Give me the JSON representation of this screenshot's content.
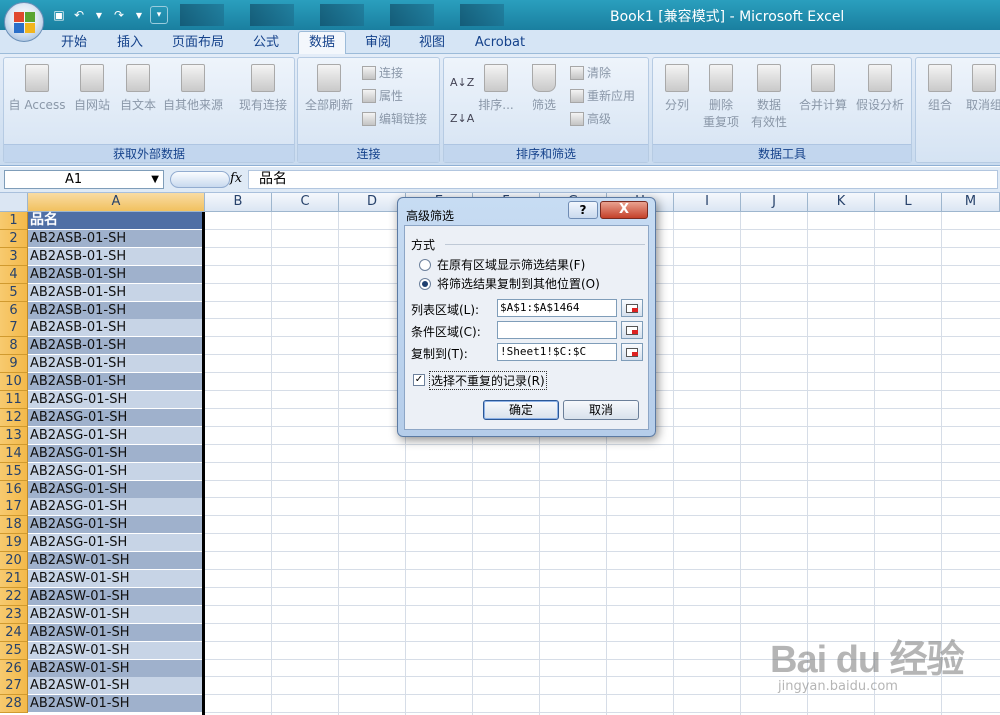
{
  "window": {
    "title": "Book1  [兼容模式] - Microsoft Excel"
  },
  "tabs": [
    {
      "label": "开始"
    },
    {
      "label": "插入"
    },
    {
      "label": "页面布局"
    },
    {
      "label": "公式"
    },
    {
      "label": "数据"
    },
    {
      "label": "审阅"
    },
    {
      "label": "视图"
    },
    {
      "label": "Acrobat"
    }
  ],
  "ribbon": {
    "get_external": {
      "label": "获取外部数据",
      "access": "自 Access",
      "web": "自网站",
      "text": "自文本",
      "other": "自其他来源",
      "existing": "现有连接"
    },
    "connections": {
      "label": "连接",
      "refresh_all": "全部刷新",
      "connect": "连接",
      "properties": "属性",
      "edit_links": "编辑链接"
    },
    "sort_filter": {
      "label": "排序和筛选",
      "sort": "排序...",
      "filter": "筛选",
      "clear": "清除",
      "reapply": "重新应用",
      "advanced": "高级"
    },
    "data_tools": {
      "label": "数据工具",
      "text_to_columns": "分列",
      "remove_dup_1": "删除",
      "remove_dup_2": "重复项",
      "validation_1": "数据",
      "validation_2": "有效性",
      "consolidate": "合并计算",
      "what_if": "假设分析"
    },
    "outline": {
      "group": "组合",
      "ungroup": "取消组"
    }
  },
  "formula_bar": {
    "name_box": "A1",
    "fx": "fx",
    "content": "品名"
  },
  "columns": [
    "A",
    "B",
    "C",
    "D",
    "E",
    "F",
    "G",
    "H",
    "I",
    "J",
    "K",
    "L",
    "M"
  ],
  "rows": [
    {
      "num": "1",
      "value": "品名"
    },
    {
      "num": "2",
      "value": "AB2ASB-01-SH"
    },
    {
      "num": "3",
      "value": "AB2ASB-01-SH"
    },
    {
      "num": "4",
      "value": "AB2ASB-01-SH"
    },
    {
      "num": "5",
      "value": "AB2ASB-01-SH"
    },
    {
      "num": "6",
      "value": "AB2ASB-01-SH"
    },
    {
      "num": "7",
      "value": "AB2ASB-01-SH"
    },
    {
      "num": "8",
      "value": "AB2ASB-01-SH"
    },
    {
      "num": "9",
      "value": "AB2ASB-01-SH"
    },
    {
      "num": "10",
      "value": "AB2ASB-01-SH"
    },
    {
      "num": "11",
      "value": "AB2ASG-01-SH"
    },
    {
      "num": "12",
      "value": "AB2ASG-01-SH"
    },
    {
      "num": "13",
      "value": "AB2ASG-01-SH"
    },
    {
      "num": "14",
      "value": "AB2ASG-01-SH"
    },
    {
      "num": "15",
      "value": "AB2ASG-01-SH"
    },
    {
      "num": "16",
      "value": "AB2ASG-01-SH"
    },
    {
      "num": "17",
      "value": "AB2ASG-01-SH"
    },
    {
      "num": "18",
      "value": "AB2ASG-01-SH"
    },
    {
      "num": "19",
      "value": "AB2ASG-01-SH"
    },
    {
      "num": "20",
      "value": "AB2ASW-01-SH"
    },
    {
      "num": "21",
      "value": "AB2ASW-01-SH"
    },
    {
      "num": "22",
      "value": "AB2ASW-01-SH"
    },
    {
      "num": "23",
      "value": "AB2ASW-01-SH"
    },
    {
      "num": "24",
      "value": "AB2ASW-01-SH"
    },
    {
      "num": "25",
      "value": "AB2ASW-01-SH"
    },
    {
      "num": "26",
      "value": "AB2ASW-01-SH"
    },
    {
      "num": "27",
      "value": "AB2ASW-01-SH"
    },
    {
      "num": "28",
      "value": "AB2ASW-01-SH"
    }
  ],
  "dialog": {
    "title": "高级筛选",
    "help": "?",
    "close": "X",
    "mode_label": "方式",
    "option_in_place": "在原有区域显示筛选结果(F)",
    "option_copy": "将筛选结果复制到其他位置(O)",
    "list_range_label": "列表区域(L):",
    "list_range_value": "$A$1:$A$1464",
    "criteria_label": "条件区域(C):",
    "criteria_value": "",
    "copy_to_label": "复制到(T):",
    "copy_to_value": "!Sheet1!$C:$C",
    "unique_label": "选择不重复的记录(R)",
    "unique_checked": true,
    "ok": "确定",
    "cancel": "取消"
  },
  "watermark": {
    "main": "Bai du 经验",
    "sub": "jingyan.baidu.com"
  }
}
